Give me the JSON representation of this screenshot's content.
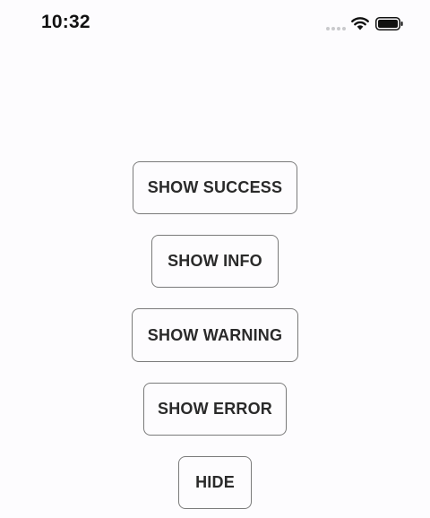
{
  "status_bar": {
    "time": "10:32",
    "icons": [
      "signal-dots-icon",
      "wifi-icon",
      "battery-icon"
    ]
  },
  "buttons": {
    "show_success": "SHOW SUCCESS",
    "show_info": "SHOW INFO",
    "show_warning": "SHOW WARNING",
    "show_error": "SHOW ERROR",
    "hide": "HIDE"
  },
  "colors": {
    "background": "#fdfcfe",
    "button_border": "#7a7a7a",
    "button_text": "#2a2a2a"
  }
}
